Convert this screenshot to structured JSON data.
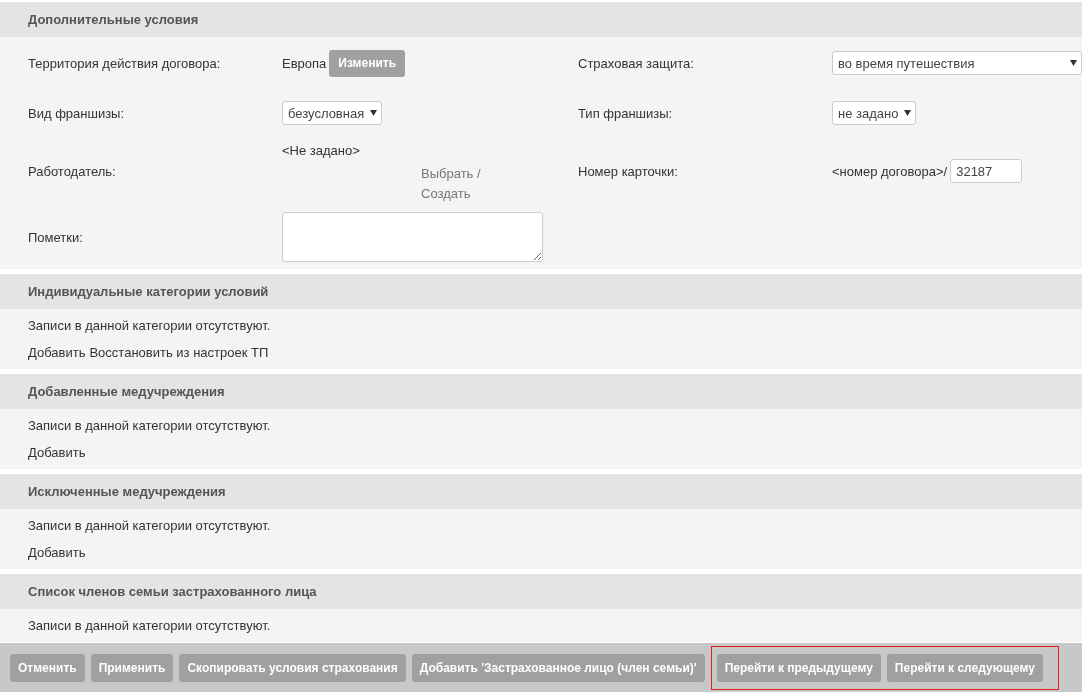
{
  "details": {
    "title": "Дополнительные условия",
    "rows": [
      {
        "left": {
          "label": "Территория действия договора:",
          "kind": "value_button",
          "value": "Европа",
          "button": "Изменить"
        },
        "right": {
          "label": "Страховая защита:",
          "kind": "dropdown_full",
          "value": "во время путешествия"
        }
      },
      {
        "left": {
          "label": "Вид франшизы:",
          "kind": "dropdown",
          "value": "безусловная"
        },
        "right": {
          "label": "Тип франшизы:",
          "kind": "dropdown",
          "value": "не задано"
        }
      },
      {
        "left": {
          "label": "Работодатель:",
          "kind": "picker",
          "value": "<Не задано>",
          "link": "Выбрать / Создать"
        },
        "right": {
          "label": "Номер карточки:",
          "kind": "prefixed_input",
          "prefix": "<номер договора>/",
          "value": "32187"
        }
      },
      {
        "left": {
          "label": "Пометки:",
          "kind": "textarea"
        }
      }
    ]
  },
  "sections": [
    {
      "title": "Индивидуальные категории условий",
      "empty_text": "Записи в данной категории отсутствуют.",
      "links": [
        "Добавить",
        "Восстановить из настроек ТП"
      ]
    },
    {
      "title": "Добавленные медучреждения",
      "empty_text": "Записи в данной категории отсутствуют.",
      "links": [
        "Добавить"
      ]
    },
    {
      "title": "Исключенные медучреждения",
      "empty_text": "Записи в данной категории отсутствуют.",
      "links": [
        "Добавить"
      ]
    },
    {
      "title": "Список членов семьи застрахованного лица",
      "empty_text": "Записи в данной категории отсутствуют."
    }
  ],
  "buttons": [
    {
      "label": "Отменить",
      "highlighted": false
    },
    {
      "label": "Применить",
      "highlighted": false
    },
    {
      "label": "Скопировать условия страхования",
      "highlighted": false
    },
    {
      "label": "Добавить 'Застрахованное лицо (член семьи)'",
      "highlighted": false
    },
    {
      "label": "Перейти к предыдущему",
      "highlighted": true
    },
    {
      "label": "Перейти к следующему",
      "highlighted": true
    }
  ]
}
